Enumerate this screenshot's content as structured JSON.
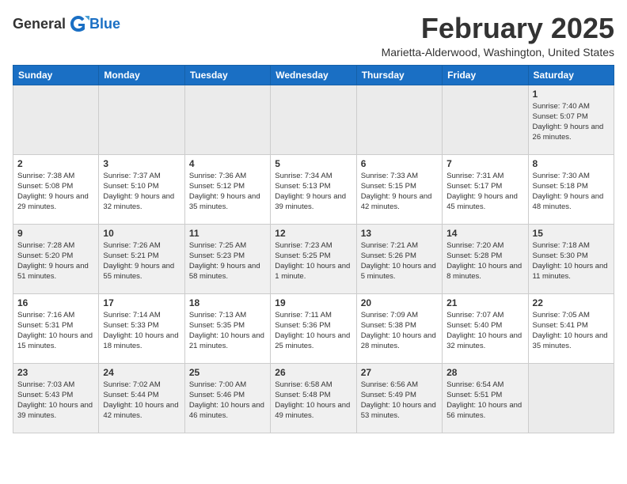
{
  "logo": {
    "general": "General",
    "blue": "Blue"
  },
  "title": "February 2025",
  "location": "Marietta-Alderwood, Washington, United States",
  "days_of_week": [
    "Sunday",
    "Monday",
    "Tuesday",
    "Wednesday",
    "Thursday",
    "Friday",
    "Saturday"
  ],
  "weeks": [
    [
      {
        "day": "",
        "info": ""
      },
      {
        "day": "",
        "info": ""
      },
      {
        "day": "",
        "info": ""
      },
      {
        "day": "",
        "info": ""
      },
      {
        "day": "",
        "info": ""
      },
      {
        "day": "",
        "info": ""
      },
      {
        "day": "1",
        "info": "Sunrise: 7:40 AM\nSunset: 5:07 PM\nDaylight: 9 hours and 26 minutes."
      }
    ],
    [
      {
        "day": "2",
        "info": "Sunrise: 7:38 AM\nSunset: 5:08 PM\nDaylight: 9 hours and 29 minutes."
      },
      {
        "day": "3",
        "info": "Sunrise: 7:37 AM\nSunset: 5:10 PM\nDaylight: 9 hours and 32 minutes."
      },
      {
        "day": "4",
        "info": "Sunrise: 7:36 AM\nSunset: 5:12 PM\nDaylight: 9 hours and 35 minutes."
      },
      {
        "day": "5",
        "info": "Sunrise: 7:34 AM\nSunset: 5:13 PM\nDaylight: 9 hours and 39 minutes."
      },
      {
        "day": "6",
        "info": "Sunrise: 7:33 AM\nSunset: 5:15 PM\nDaylight: 9 hours and 42 minutes."
      },
      {
        "day": "7",
        "info": "Sunrise: 7:31 AM\nSunset: 5:17 PM\nDaylight: 9 hours and 45 minutes."
      },
      {
        "day": "8",
        "info": "Sunrise: 7:30 AM\nSunset: 5:18 PM\nDaylight: 9 hours and 48 minutes."
      }
    ],
    [
      {
        "day": "9",
        "info": "Sunrise: 7:28 AM\nSunset: 5:20 PM\nDaylight: 9 hours and 51 minutes."
      },
      {
        "day": "10",
        "info": "Sunrise: 7:26 AM\nSunset: 5:21 PM\nDaylight: 9 hours and 55 minutes."
      },
      {
        "day": "11",
        "info": "Sunrise: 7:25 AM\nSunset: 5:23 PM\nDaylight: 9 hours and 58 minutes."
      },
      {
        "day": "12",
        "info": "Sunrise: 7:23 AM\nSunset: 5:25 PM\nDaylight: 10 hours and 1 minute."
      },
      {
        "day": "13",
        "info": "Sunrise: 7:21 AM\nSunset: 5:26 PM\nDaylight: 10 hours and 5 minutes."
      },
      {
        "day": "14",
        "info": "Sunrise: 7:20 AM\nSunset: 5:28 PM\nDaylight: 10 hours and 8 minutes."
      },
      {
        "day": "15",
        "info": "Sunrise: 7:18 AM\nSunset: 5:30 PM\nDaylight: 10 hours and 11 minutes."
      }
    ],
    [
      {
        "day": "16",
        "info": "Sunrise: 7:16 AM\nSunset: 5:31 PM\nDaylight: 10 hours and 15 minutes."
      },
      {
        "day": "17",
        "info": "Sunrise: 7:14 AM\nSunset: 5:33 PM\nDaylight: 10 hours and 18 minutes."
      },
      {
        "day": "18",
        "info": "Sunrise: 7:13 AM\nSunset: 5:35 PM\nDaylight: 10 hours and 21 minutes."
      },
      {
        "day": "19",
        "info": "Sunrise: 7:11 AM\nSunset: 5:36 PM\nDaylight: 10 hours and 25 minutes."
      },
      {
        "day": "20",
        "info": "Sunrise: 7:09 AM\nSunset: 5:38 PM\nDaylight: 10 hours and 28 minutes."
      },
      {
        "day": "21",
        "info": "Sunrise: 7:07 AM\nSunset: 5:40 PM\nDaylight: 10 hours and 32 minutes."
      },
      {
        "day": "22",
        "info": "Sunrise: 7:05 AM\nSunset: 5:41 PM\nDaylight: 10 hours and 35 minutes."
      }
    ],
    [
      {
        "day": "23",
        "info": "Sunrise: 7:03 AM\nSunset: 5:43 PM\nDaylight: 10 hours and 39 minutes."
      },
      {
        "day": "24",
        "info": "Sunrise: 7:02 AM\nSunset: 5:44 PM\nDaylight: 10 hours and 42 minutes."
      },
      {
        "day": "25",
        "info": "Sunrise: 7:00 AM\nSunset: 5:46 PM\nDaylight: 10 hours and 46 minutes."
      },
      {
        "day": "26",
        "info": "Sunrise: 6:58 AM\nSunset: 5:48 PM\nDaylight: 10 hours and 49 minutes."
      },
      {
        "day": "27",
        "info": "Sunrise: 6:56 AM\nSunset: 5:49 PM\nDaylight: 10 hours and 53 minutes."
      },
      {
        "day": "28",
        "info": "Sunrise: 6:54 AM\nSunset: 5:51 PM\nDaylight: 10 hours and 56 minutes."
      },
      {
        "day": "",
        "info": ""
      }
    ]
  ]
}
